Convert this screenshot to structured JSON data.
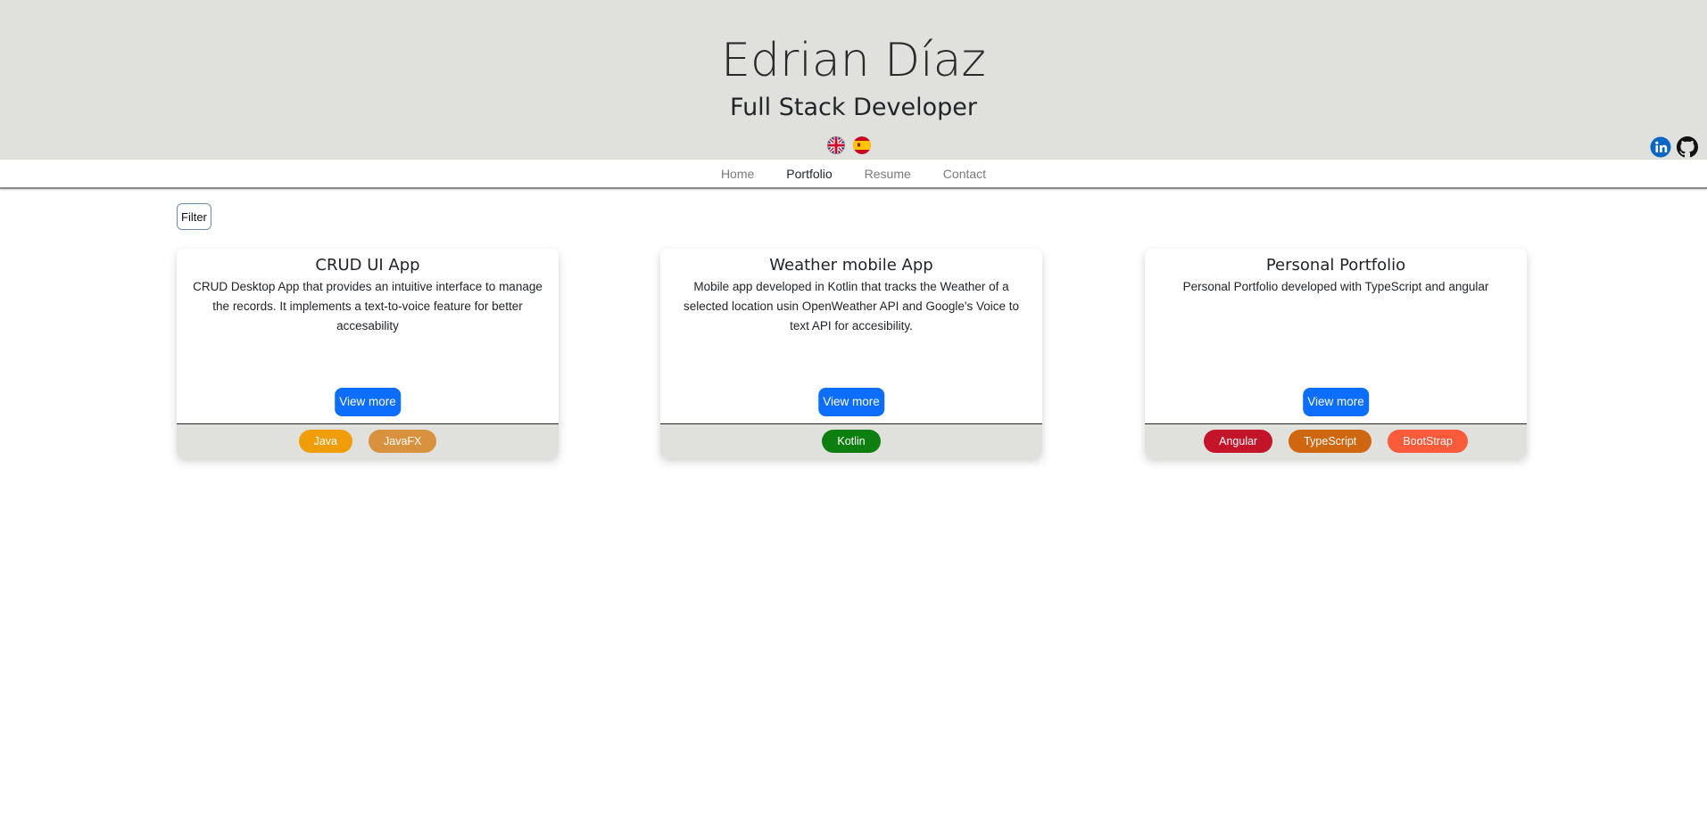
{
  "header": {
    "name": "Edrian Díaz",
    "role": "Full Stack Developer",
    "flags": [
      {
        "icon": "uk-flag-icon"
      },
      {
        "icon": "spain-flag-icon"
      }
    ],
    "socials": [
      {
        "icon": "linkedin-icon",
        "color": "#0a66c2"
      },
      {
        "icon": "github-icon",
        "color": "#111111"
      }
    ]
  },
  "nav": {
    "items": [
      {
        "label": "Home",
        "active": false
      },
      {
        "label": "Portfolio",
        "active": true
      },
      {
        "label": "Resume",
        "active": false
      },
      {
        "label": "Contact",
        "active": false
      }
    ]
  },
  "filter": {
    "label": "Filter"
  },
  "projects": [
    {
      "title": "CRUD UI App",
      "description": "CRUD Desktop App that provides an intuitive interface to manage the records. It implements a text-to-voice feature for better accesability",
      "button": "View more",
      "tags": [
        {
          "label": "Java",
          "color": "#f09d0a"
        },
        {
          "label": "JavaFX",
          "color": "#d8913d"
        }
      ]
    },
    {
      "title": "Weather mobile App",
      "description": "Mobile app developed in Kotlin that tracks the Weather of a selected location usin OpenWeather API and Google's Voice to text API for accesibility.",
      "button": "View more",
      "tags": [
        {
          "label": "Kotlin",
          "color": "#0d7f10"
        }
      ]
    },
    {
      "title": "Personal Portfolio",
      "description": "Personal Portfolio developed with TypeScript and angular",
      "button": "View more",
      "tags": [
        {
          "label": "Angular",
          "color": "#c3142a"
        },
        {
          "label": "TypeScript",
          "color": "#cf6710"
        },
        {
          "label": "BootStrap",
          "color": "#fb5b3a"
        }
      ]
    }
  ],
  "colors": {
    "header_bg": "#e0e0dc",
    "primary": "#0d6efd"
  }
}
